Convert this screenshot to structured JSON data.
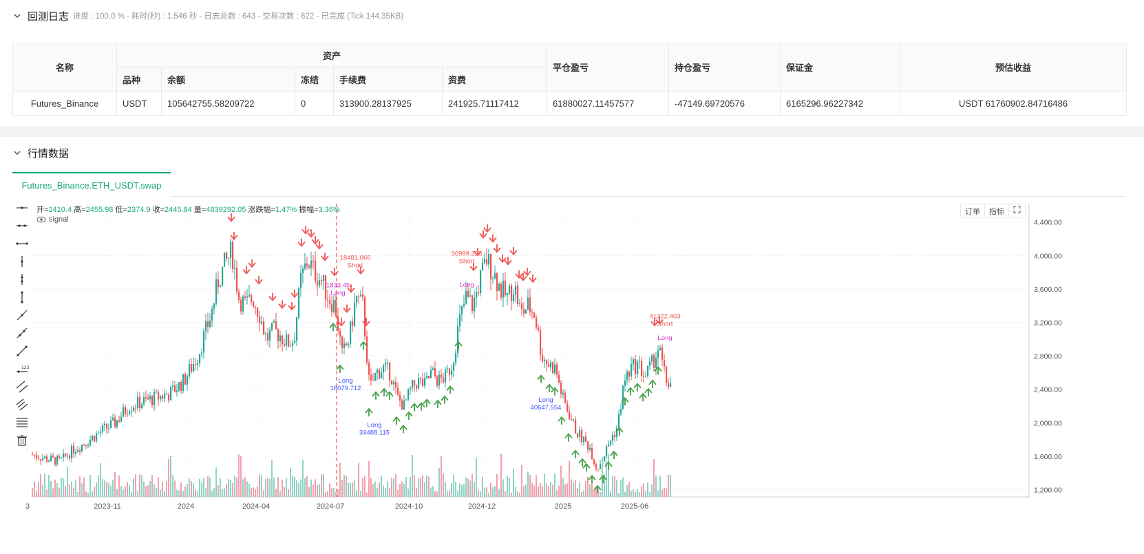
{
  "log": {
    "title": "回测日志",
    "subtitle": "进度 : 100.0 % - 耗时(秒) : 1.546  秒 - 日志总数 : 643 - 交易次数 : 622 - 已完成 (Tick 144.35KB)"
  },
  "assets_table": {
    "headers": {
      "name": "名称",
      "assets": "资产",
      "variety": "品种",
      "balance": "余额",
      "frozen": "冻结",
      "fee": "手续费",
      "funding": "资费",
      "close_pnl": "平仓盈亏",
      "hold_pnl": "持仓盈亏",
      "margin": "保证金",
      "est_profit": "预估收益"
    },
    "row": {
      "name": "Futures_Binance",
      "variety": "USDT",
      "balance": "105642755.58209722",
      "frozen": "0",
      "fee": "313900.28137925",
      "funding": "241925.71117412",
      "close_pnl": "61880027.11457577",
      "hold_pnl": "-47149.69720576",
      "margin": "6165296.96227342",
      "est_profit": "USDT 61760902.84716486"
    }
  },
  "market": {
    "title": "行情数据",
    "tab": "Futures_Binance.ETH_USDT.swap",
    "ohlc": {
      "open_label": "开=",
      "open": "2410.4",
      "high_label": "高=",
      "high": "2455.98",
      "low_label": "低=",
      "low": "2374.9",
      "close_label": "收=",
      "close": "2445.84",
      "vol_label": "量=",
      "vol": "4839292.05",
      "chg_label": "涨跌幅=",
      "chg": "1.47%",
      "amp_label": "振幅=",
      "amp": "3.36%"
    },
    "signal_label": "signal",
    "buttons": [
      "订单",
      "指标"
    ]
  },
  "colors": {
    "up": "#26a69a",
    "down": "#ef5350",
    "green_arrow": "#43a047",
    "blue_arrow": "#3f51f5",
    "magenta": "#d32fd3",
    "accent": "#19a979"
  },
  "chart_data": {
    "type": "candlestick",
    "series": "ETH_USDT",
    "y_ticks": [
      4400,
      4000,
      3600,
      3200,
      2800,
      2400,
      2000,
      1600,
      1200
    ],
    "x_ticks": [
      "3",
      "2023-11",
      "2024",
      "2024-04",
      "2024-07",
      "2024-10",
      "2024-12",
      "2025",
      "2025-06"
    ],
    "ylim": [
      1130,
      4620
    ],
    "close_path": [
      [
        0,
        1620
      ],
      [
        20,
        1570
      ],
      [
        40,
        1540
      ],
      [
        60,
        1680
      ],
      [
        80,
        1780
      ],
      [
        100,
        1900
      ],
      [
        120,
        2000
      ],
      [
        140,
        2200
      ],
      [
        160,
        2250
      ],
      [
        180,
        2300
      ],
      [
        200,
        2350
      ],
      [
        220,
        2500
      ],
      [
        240,
        2800
      ],
      [
        260,
        3300
      ],
      [
        270,
        3700
      ],
      [
        280,
        3900
      ],
      [
        290,
        4050
      ],
      [
        300,
        3500
      ],
      [
        310,
        3400
      ],
      [
        320,
        3500
      ],
      [
        330,
        3300
      ],
      [
        340,
        3000
      ],
      [
        350,
        3100
      ],
      [
        360,
        3050
      ],
      [
        370,
        2950
      ],
      [
        380,
        3000
      ],
      [
        390,
        3700
      ],
      [
        400,
        3950
      ],
      [
        410,
        3800
      ],
      [
        420,
        3700
      ],
      [
        430,
        3500
      ],
      [
        440,
        3400
      ],
      [
        450,
        2800
      ],
      [
        460,
        3000
      ],
      [
        470,
        3500
      ],
      [
        480,
        3400
      ],
      [
        490,
        2400
      ],
      [
        500,
        2600
      ],
      [
        510,
        2650
      ],
      [
        520,
        2600
      ],
      [
        530,
        2300
      ],
      [
        540,
        2200
      ],
      [
        550,
        2400
      ],
      [
        560,
        2500
      ],
      [
        570,
        2450
      ],
      [
        580,
        2600
      ],
      [
        590,
        2500
      ],
      [
        600,
        2550
      ],
      [
        610,
        2700
      ],
      [
        620,
        3200
      ],
      [
        630,
        3500
      ],
      [
        640,
        3400
      ],
      [
        650,
        3700
      ],
      [
        660,
        3950
      ],
      [
        670,
        3800
      ],
      [
        680,
        3600
      ],
      [
        690,
        3500
      ],
      [
        700,
        3650
      ],
      [
        710,
        3300
      ],
      [
        720,
        3400
      ],
      [
        730,
        3300
      ],
      [
        740,
        2800
      ],
      [
        750,
        2700
      ],
      [
        760,
        2650
      ],
      [
        770,
        2300
      ],
      [
        780,
        2100
      ],
      [
        790,
        1900
      ],
      [
        800,
        1800
      ],
      [
        810,
        1700
      ],
      [
        820,
        1450
      ],
      [
        830,
        1600
      ],
      [
        840,
        1800
      ],
      [
        850,
        1950
      ],
      [
        860,
        2500
      ],
      [
        870,
        2650
      ],
      [
        880,
        2700
      ],
      [
        890,
        2550
      ],
      [
        900,
        2700
      ],
      [
        910,
        2900
      ],
      [
        920,
        2500
      ],
      [
        930,
        2450
      ]
    ],
    "annotations": [
      {
        "text": "18481.066",
        "sub": "Short",
        "x": 470,
        "y": 3950
      },
      {
        "text": "30999.326",
        "sub": "Short",
        "x": 632,
        "y": 4000
      },
      {
        "text": "41322.403",
        "sub": "Short",
        "x": 920,
        "y": 3250
      },
      {
        "text": "1833.45",
        "sub": "Long",
        "x": 445,
        "y": 3620
      },
      {
        "text": "Long",
        "sub": "",
        "x": 632,
        "y": 3630
      },
      {
        "text": "Long",
        "sub": "",
        "x": 920,
        "y": 2990
      },
      {
        "text": "Long",
        "sub": "18079.712",
        "x": 456,
        "y": 2480
      },
      {
        "text": "Long",
        "sub": "33488.115",
        "x": 498,
        "y": 1950
      },
      {
        "text": "Long",
        "sub": "40647.554",
        "x": 747,
        "y": 2250
      }
    ],
    "vline_x": 443
  }
}
